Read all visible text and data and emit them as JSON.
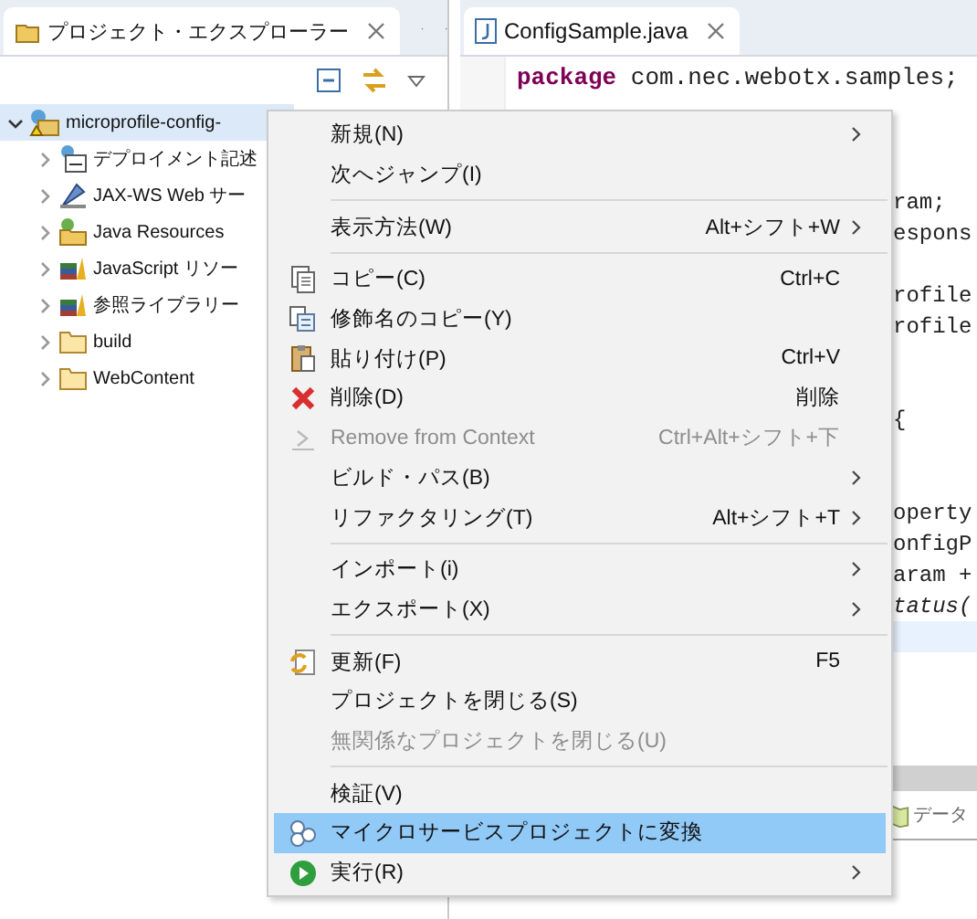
{
  "explorer": {
    "tab": "プロジェクト・エクスプローラー",
    "tree": [
      {
        "label": "microprofile-config-",
        "kind": "project",
        "expanded": true,
        "selected": true,
        "children": [
          {
            "label": "デプロイメント記述",
            "kind": "descriptor",
            "expanded": false,
            "selected": false
          },
          {
            "label": "JAX-WS Web サー",
            "kind": "webservice",
            "expanded": false,
            "selected": false
          },
          {
            "label": "Java Resources",
            "kind": "resources",
            "expanded": false,
            "selected": false
          },
          {
            "label": "JavaScript リソー",
            "kind": "library",
            "expanded": false,
            "selected": false
          },
          {
            "label": "参照ライブラリー",
            "kind": "library",
            "expanded": false,
            "selected": false
          },
          {
            "label": "build",
            "kind": "folder",
            "expanded": false,
            "selected": false
          },
          {
            "label": "WebContent",
            "kind": "folder",
            "expanded": false,
            "selected": false
          }
        ]
      }
    ]
  },
  "editor": {
    "tab": "ConfigSample.java",
    "lines": [
      {
        "kind": "full",
        "keyword": "package",
        "text": " com.nec.webotx.samples;",
        "current": false
      },
      {
        "kind": "blank",
        "current": false
      },
      {
        "kind": "blank",
        "current": false
      },
      {
        "kind": "blank",
        "current": false
      },
      {
        "kind": "fragment",
        "text": "ram;",
        "current": false
      },
      {
        "kind": "fragment",
        "text": "espons",
        "current": false
      },
      {
        "kind": "blank",
        "current": false
      },
      {
        "kind": "fragment",
        "text": "rofile",
        "current": false
      },
      {
        "kind": "fragment",
        "text": "rofile",
        "current": false
      },
      {
        "kind": "blank",
        "current": false
      },
      {
        "kind": "blank",
        "current": false
      },
      {
        "kind": "fragment",
        "text": " {",
        "current": false
      },
      {
        "kind": "blank",
        "current": false
      },
      {
        "kind": "blank",
        "current": false
      },
      {
        "kind": "fragment",
        "text": "operty",
        "current": false
      },
      {
        "kind": "fragment",
        "text": "onfigP",
        "current": false
      },
      {
        "kind": "fragment",
        "text": "aram +",
        "current": false
      },
      {
        "kind": "fragment",
        "text": "tatus(",
        "italic": true,
        "current": false
      },
      {
        "kind": "blank",
        "current": true
      }
    ]
  },
  "bottom_panel": {
    "tab": "データ"
  },
  "context_menu": [
    {
      "kind": "plain",
      "label": "新規(N)",
      "submenu": true,
      "disabled": false,
      "selected": false
    },
    {
      "kind": "plain",
      "label": "次へジャンプ(I)",
      "submenu": false,
      "disabled": false,
      "selected": false
    },
    {
      "kind": "separator"
    },
    {
      "kind": "plain",
      "label": "表示方法(W)",
      "shortcut": "Alt+シフト+W",
      "submenu": true,
      "disabled": false,
      "selected": false
    },
    {
      "kind": "separator"
    },
    {
      "kind": "copy",
      "label": "コピー(C)",
      "shortcut": "Ctrl+C",
      "submenu": false,
      "disabled": false,
      "selected": false
    },
    {
      "kind": "copy-qualified",
      "label": "修飾名のコピー(Y)",
      "submenu": false,
      "disabled": false,
      "selected": false
    },
    {
      "kind": "paste",
      "label": "貼り付け(P)",
      "shortcut": "Ctrl+V",
      "submenu": false,
      "disabled": false,
      "selected": false
    },
    {
      "kind": "delete",
      "label": "削除(D)",
      "shortcut": "削除",
      "submenu": false,
      "disabled": false,
      "selected": false
    },
    {
      "kind": "remove",
      "label": "Remove from Context",
      "shortcut": "Ctrl+Alt+シフト+下",
      "submenu": false,
      "disabled": true,
      "selected": false
    },
    {
      "kind": "plain",
      "label": "ビルド・パス(B)",
      "submenu": true,
      "disabled": false,
      "selected": false
    },
    {
      "kind": "plain",
      "label": "リファクタリング(T)",
      "shortcut": "Alt+シフト+T",
      "submenu": true,
      "disabled": false,
      "selected": false
    },
    {
      "kind": "separator"
    },
    {
      "kind": "plain",
      "label": "インポート(i)",
      "submenu": true,
      "disabled": false,
      "selected": false
    },
    {
      "kind": "plain",
      "label": "エクスポート(X)",
      "submenu": true,
      "disabled": false,
      "selected": false
    },
    {
      "kind": "separator"
    },
    {
      "kind": "refresh",
      "label": "更新(F)",
      "shortcut": "F5",
      "submenu": false,
      "disabled": false,
      "selected": false
    },
    {
      "kind": "plain",
      "label": "プロジェクトを閉じる(S)",
      "submenu": false,
      "disabled": false,
      "selected": false
    },
    {
      "kind": "plain",
      "label": "無関係なプロジェクトを閉じる(U)",
      "submenu": false,
      "disabled": true,
      "selected": false
    },
    {
      "kind": "separator"
    },
    {
      "kind": "plain",
      "label": "検証(V)",
      "submenu": false,
      "disabled": false,
      "selected": false
    },
    {
      "kind": "microservice",
      "label": "マイクロサービスプロジェクトに変換",
      "submenu": false,
      "disabled": false,
      "selected": true
    },
    {
      "kind": "run",
      "label": "実行(R)",
      "submenu": true,
      "disabled": false,
      "selected": false
    }
  ]
}
